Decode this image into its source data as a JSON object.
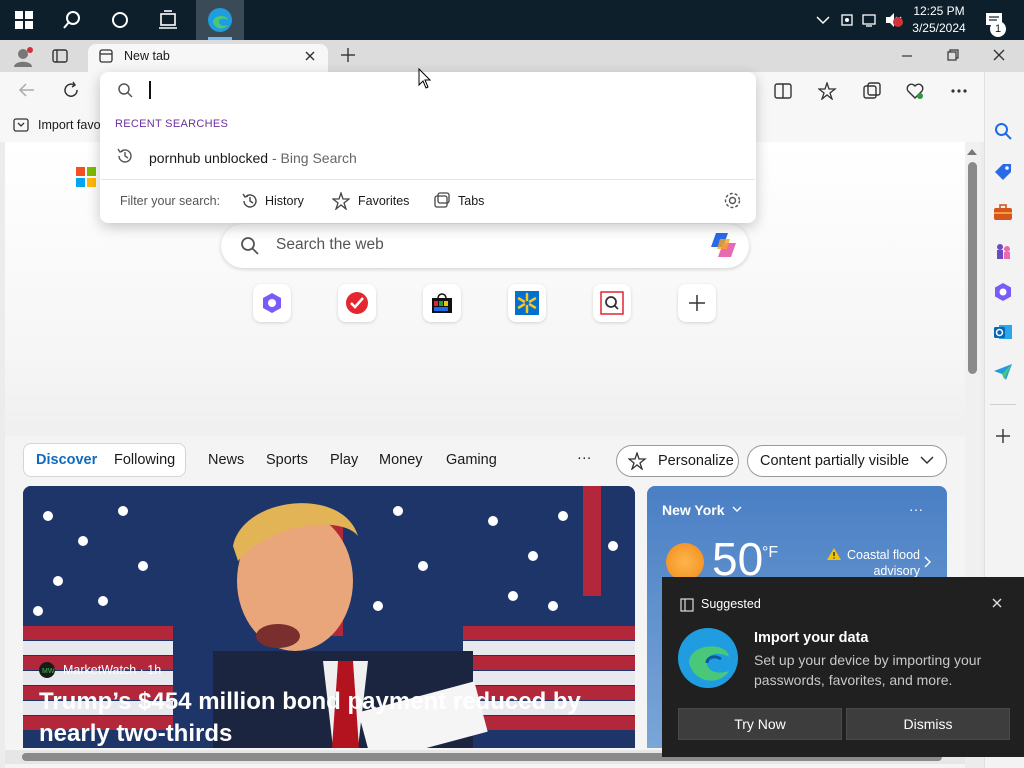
{
  "taskbar": {
    "time": "12:25 PM",
    "date": "3/25/2024",
    "notification_count": "1"
  },
  "browser": {
    "tab_title": "New tab",
    "favorites_bar_text": "Import favo",
    "address_dropdown": {
      "section_label": "RECENT SEARCHES",
      "recent_query": "pornhub unblocked",
      "recent_suffix": " - Bing Search",
      "filter_label": "Filter your search:",
      "filters": [
        "History",
        "Favorites",
        "Tabs"
      ]
    }
  },
  "newtab": {
    "search_placeholder": "Search the web"
  },
  "feed": {
    "nav": [
      "Discover",
      "Following",
      "News",
      "Sports",
      "Play",
      "Money",
      "Gaming"
    ],
    "more": "···",
    "personalize": "Personalize",
    "content_visibility": "Content partially visible",
    "hero": {
      "source": "MarketWatch · 1h",
      "headline": "Trump’s $454 million bond payment reduced by nearly two-thirds"
    },
    "weather": {
      "city": "New York",
      "temperature": "50",
      "unit": "°F",
      "alert": "Coastal flood advisory"
    }
  },
  "toast": {
    "title": "Suggested",
    "heading": "Import your data",
    "body": "Set up your device by importing your passwords, favorites, and more.",
    "try_now": "Try Now",
    "dismiss": "Dismiss"
  },
  "colors": {
    "taskbar": "#0d1f2b",
    "accent_purple": "#6b2fa0",
    "discover_blue": "#0f6cbd",
    "toast_bg": "#202020"
  }
}
